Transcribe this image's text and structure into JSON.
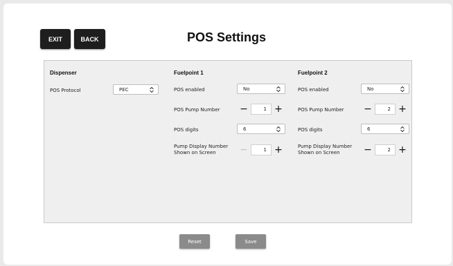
{
  "header": {
    "exit_label": "EXIT",
    "back_label": "BACK",
    "title": "POS Settings"
  },
  "dispenser": {
    "heading": "Dispenser",
    "protocol_label": "POS Protocol",
    "protocol_value": "PEC"
  },
  "fuelpoint1": {
    "heading": "Fuelpoint 1",
    "enabled_label": "POS enabled",
    "enabled_value": "No",
    "pump_number_label": "POS Pump Number",
    "pump_number_value": "1",
    "digits_label": "POS digits",
    "digits_value": "6",
    "display_label_1": "Pump Display Number",
    "display_label_2": "Shown on Screen",
    "display_value": "1"
  },
  "fuelpoint2": {
    "heading": "Fuelpoint 2",
    "enabled_label": "POS enabled",
    "enabled_value": "No",
    "pump_number_label": "POS Pump Number",
    "pump_number_value": "2",
    "digits_label": "POS digits",
    "digits_value": "6",
    "display_label_1": "Pump Display Number",
    "display_label_2": "Shown on Screen",
    "display_value": "2"
  },
  "stepper": {
    "minus": "−",
    "plus": "+"
  },
  "footer": {
    "reset_label": "Reset",
    "save_label": "Save"
  }
}
